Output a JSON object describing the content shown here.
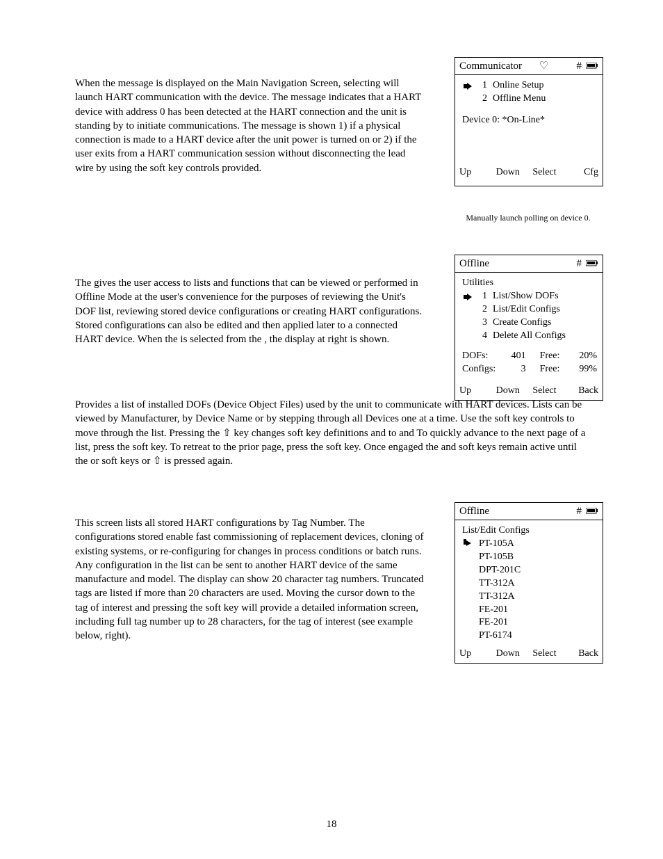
{
  "page_number": "18",
  "paragraphs": {
    "p1": "When the message is displayed on the Main Navigation Screen, selecting will launch HART communication with the device. The message indicates that a HART device with address 0 has been detected at the HART connection and the unit is standing by to initiate communications. The message is shown 1) if a physical connection is made to a HART device after the unit power is turned on or 2) if the user exits from a HART communication session without disconnecting the lead wire by using the soft key controls provided.",
    "p2": "The gives the user access to lists and functions that can be viewed or performed in Offline Mode at the user's convenience for the purposes of reviewing the Unit's DOF list, reviewing stored device configurations or creating HART configurations. Stored configurations can also be edited and then applied later to a connected HART device. When the is selected from the , the display at right is shown.",
    "p3": "Provides a list of installed DOFs (Device Object Files) used by the unit to communicate with HART devices. Lists can be viewed by Manufacturer, by Device Name or by stepping through all Devices one at a time. Use the soft key controls to move through the list. Pressing the ⇧ key changes soft key definitions and to and To quickly advance to the next page of a list, press the soft key. To retreat to the prior page, press the soft key. Once engaged the and soft keys remain active until the or soft keys or ⇧ is pressed again.",
    "p4": "This screen lists all stored HART configurations by Tag Number. The configurations stored enable fast commissioning of replacement devices, cloning of existing systems, or re-configuring for changes in process conditions or batch runs. Any configuration in the list can be sent to another HART device of the same manufacture and model. The display can show 20 character tag numbers. Truncated tags are listed if more than 20 characters are used. Moving the cursor down to the tag of interest and pressing the soft key will provide a detailed information screen, including full tag number up to 28 characters, for the tag of interest (see example below, right)."
  },
  "box1": {
    "title": "Communicator",
    "heart": "♡",
    "hash": "#",
    "menu": [
      {
        "num": "1",
        "label": "Online Setup",
        "selected": true
      },
      {
        "num": "2",
        "label": "Offline Menu",
        "selected": false
      }
    ],
    "status": "Device  0:  *On-Line*",
    "softkeys": [
      "Up",
      "Down",
      "Select",
      "Cfg"
    ]
  },
  "caption1": "Manually launch polling on device 0.",
  "box2": {
    "title": "Offline",
    "hash": "#",
    "subtitle": "Utilities",
    "menu": [
      {
        "num": "1",
        "label": "List/Show DOFs",
        "selected": true
      },
      {
        "num": "2",
        "label": "List/Edit Configs",
        "selected": false
      },
      {
        "num": "3",
        "label": "Create Configs",
        "selected": false
      },
      {
        "num": "4",
        "label": "Delete All Configs",
        "selected": false
      }
    ],
    "stats": {
      "dofs_label": "DOFs:",
      "dofs_value": "401",
      "dofs_free_label": "Free:",
      "dofs_free_value": "20%",
      "configs_label": "Configs:",
      "configs_value": "3",
      "configs_free_label": "Free:",
      "configs_free_value": "99%"
    },
    "softkeys": [
      "Up",
      "Down",
      "Select",
      "Back"
    ]
  },
  "box3": {
    "title": "Offline",
    "hash": "#",
    "subtitle": "List/Edit Configs",
    "items": [
      "PT-105A",
      "PT-105B",
      "DPT-201C",
      "TT-312A",
      "TT-312A",
      "FE-201",
      "FE-201",
      "PT-6174"
    ],
    "softkeys": [
      "Up",
      "Down",
      "Select",
      "Back"
    ]
  }
}
